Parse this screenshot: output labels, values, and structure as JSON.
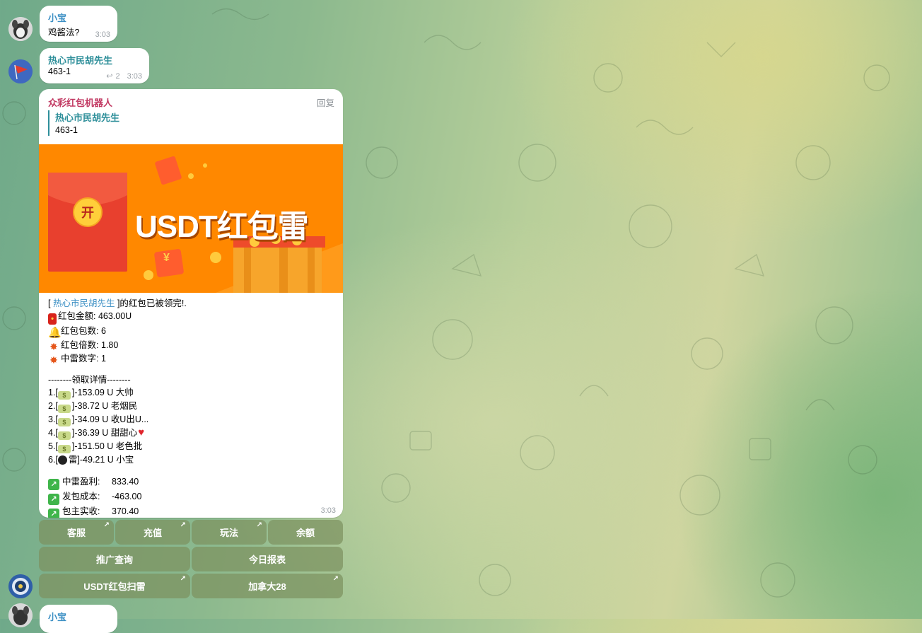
{
  "messages": [
    {
      "sender": "小宝",
      "text": "鸡酱法?",
      "time": "3:03"
    },
    {
      "sender": "热心市民胡先生",
      "text": "463-1",
      "replies": "2",
      "time": "3:03"
    }
  ],
  "bot": {
    "sender": "众彩红包机器人",
    "reply_label": "回复",
    "quote_sender": "热心市民胡先生",
    "quote_text": "463-1",
    "banner_title": "USDT红包雷",
    "banner_badge": "开",
    "banner_symbol": "¥",
    "claimed_open": "[ ",
    "claimed_name": "热心市民胡先生",
    "claimed_rest": " ]的红包已被领完!.",
    "amount": "红包金额: 463.00U",
    "count": "红包包数: 6",
    "multiplier": "红包倍数: 1.80",
    "mine_number": "中雷数字: 1",
    "details_header": "--------领取详情--------",
    "details": [
      {
        "prefix": "1.[",
        "suffix": "]-153.09 U  大帅"
      },
      {
        "prefix": "2.[",
        "suffix": "]-38.72 U  老烟民"
      },
      {
        "prefix": "3.[",
        "suffix": "]-34.09 U  收U出U..."
      },
      {
        "prefix": "4.[",
        "suffix": "]-36.39 U  甜甜心"
      },
      {
        "prefix": "5.[",
        "suffix": "]-151.50 U  老色批"
      },
      {
        "prefix": "6.[",
        "suffix": "雷]-49.21 U  小宝"
      }
    ],
    "summary": [
      {
        "label": "中雷盈利:",
        "value": "833.40"
      },
      {
        "label": "发包成本:",
        "value": "-463.00"
      },
      {
        "label": "包主实收:",
        "value": "370.40"
      }
    ],
    "time": "3:03"
  },
  "keyboard": {
    "row1": [
      "客服",
      "充值",
      "玩法",
      "余额"
    ],
    "row2": [
      "推广查询",
      "今日报表"
    ],
    "row3": [
      "USDT红包扫雷",
      "加拿大28"
    ]
  },
  "next_message": {
    "sender": "小宝"
  }
}
